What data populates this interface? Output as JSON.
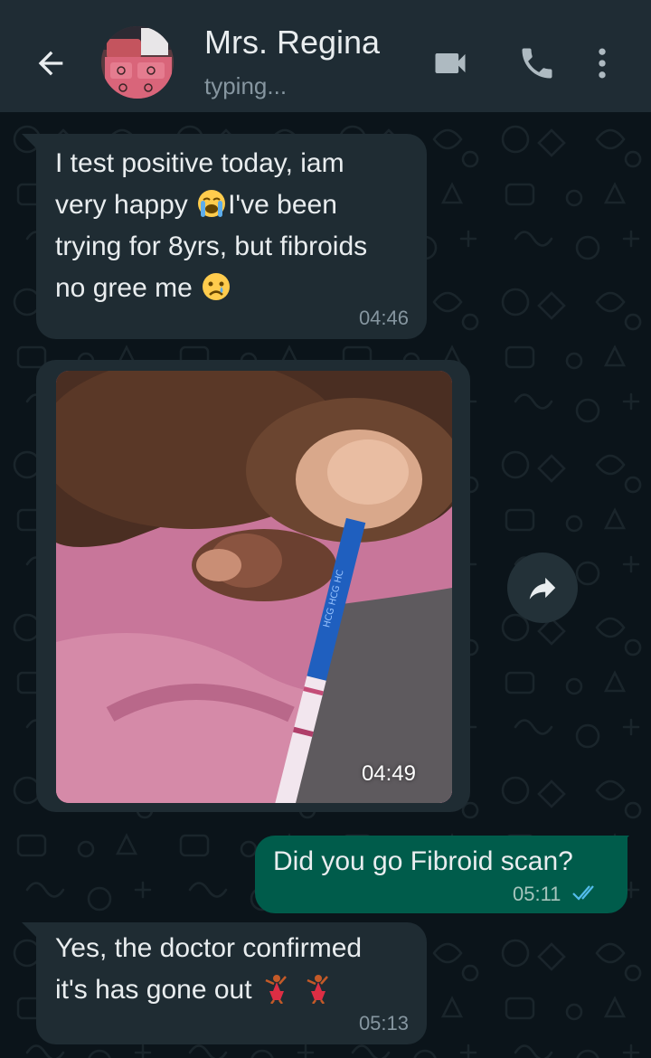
{
  "header": {
    "contact_name": "Mrs. Regina",
    "status": "typing...",
    "icons": {
      "back": "arrow-left-icon",
      "video": "video-camera-icon",
      "call": "phone-icon",
      "menu": "more-vertical-icon"
    }
  },
  "messages": [
    {
      "direction": "incoming",
      "type": "text",
      "line1": "I test positive today, iam",
      "line2a": "very happy ",
      "line2b": "I've been",
      "line3": "trying for 8yrs, but fibroids",
      "line4": "no gree me ",
      "emojis": [
        "loudly-crying-face",
        "crying-face"
      ],
      "time": "04:46"
    },
    {
      "direction": "incoming",
      "type": "image",
      "strip_text": "HCG HCG HC",
      "time": "04:49"
    },
    {
      "direction": "outgoing",
      "type": "text",
      "text": "Did you go Fibroid scan?",
      "time": "05:11",
      "status": "read"
    },
    {
      "direction": "incoming",
      "type": "text",
      "line1": "Yes, the doctor confirmed",
      "line2": "it's has gone out ",
      "emojis": [
        "dancer",
        "dancer"
      ],
      "time": "05:13"
    }
  ],
  "colors": {
    "background": "#0b141a",
    "header": "#1f2c34",
    "incoming_bubble": "#1f2c33",
    "outgoing_bubble": "#005c4b",
    "read_ticks": "#53bdeb"
  }
}
